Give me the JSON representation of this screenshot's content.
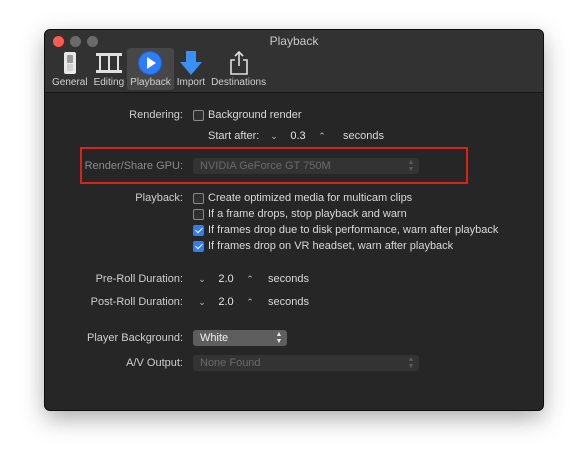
{
  "window": {
    "title": "Playback"
  },
  "toolbar": {
    "tabs": [
      {
        "label": "General"
      },
      {
        "label": "Editing"
      },
      {
        "label": "Playback"
      },
      {
        "label": "Import"
      },
      {
        "label": "Destinations"
      }
    ]
  },
  "rendering": {
    "label": "Rendering:",
    "background_render": "Background render",
    "start_after_label": "Start after:",
    "start_after_value": "0.3",
    "start_after_unit": "seconds"
  },
  "gpu": {
    "label": "Render/Share GPU:",
    "value": "NVIDIA GeForce GT 750M"
  },
  "playback": {
    "label": "Playback:",
    "options": [
      {
        "label": "Create optimized media for multicam clips",
        "checked": false
      },
      {
        "label": "If a frame drops, stop playback and warn",
        "checked": false
      },
      {
        "label": "If frames drop due to disk performance, warn after playback",
        "checked": true
      },
      {
        "label": "If frames drop on VR headset, warn after playback",
        "checked": true
      }
    ]
  },
  "preroll": {
    "label": "Pre-Roll Duration:",
    "value": "2.0",
    "unit": "seconds"
  },
  "postroll": {
    "label": "Post-Roll Duration:",
    "value": "2.0",
    "unit": "seconds"
  },
  "player_background": {
    "label": "Player Background:",
    "value": "White"
  },
  "av_output": {
    "label": "A/V Output:",
    "value": "None Found"
  },
  "colors": {
    "accent": "#2f7cf6",
    "highlight": "#d8221a",
    "close_button": "#fc5a52"
  }
}
